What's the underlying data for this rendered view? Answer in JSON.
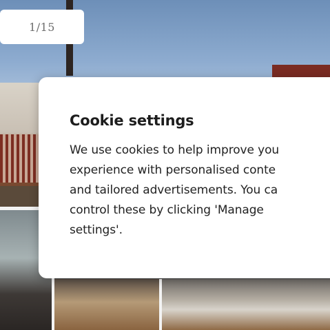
{
  "gallery": {
    "counter": "1/15"
  },
  "cookie_dialog": {
    "title": "Cookie settings",
    "body": "We use cookies to help improve you\nexperience with personalised conte\nand tailored advertisements. You ca\ncontrol these by clicking 'Manage\nsettings'."
  }
}
